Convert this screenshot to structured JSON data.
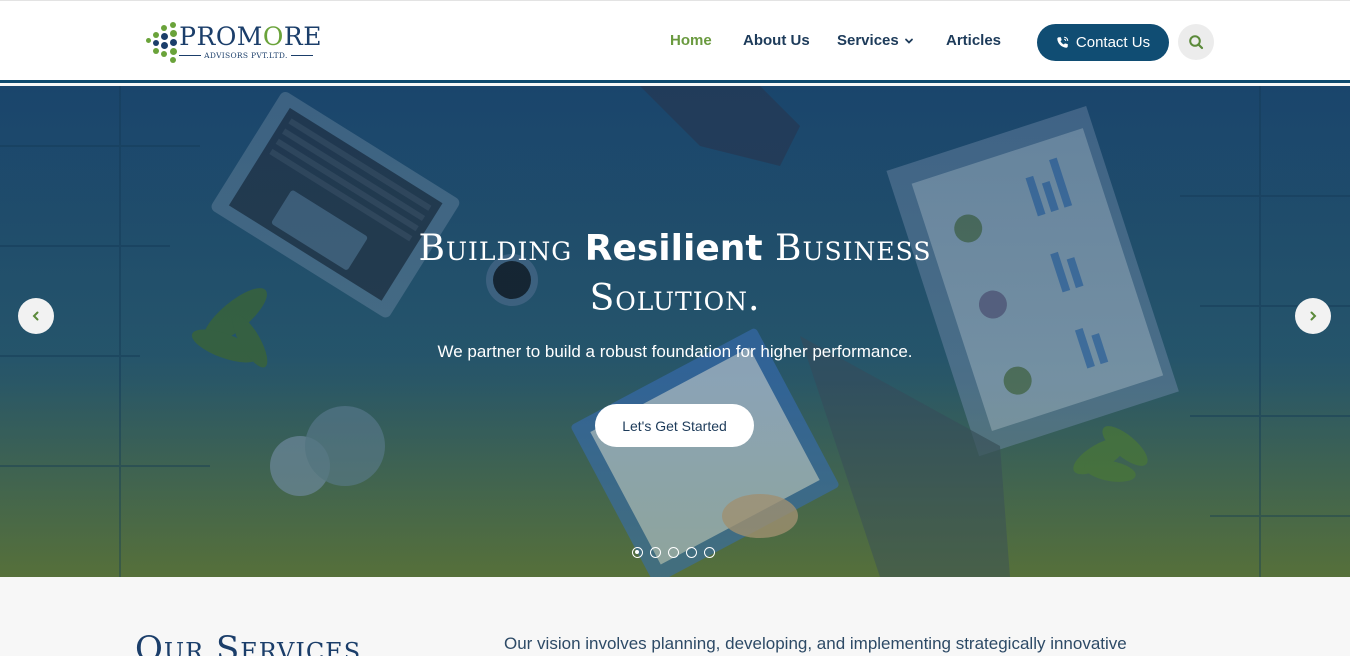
{
  "logo": {
    "name_prefix": "PROM",
    "name_o": "O",
    "name_suffix": "RE",
    "tagline": "ADVISORS PVT.LTD.",
    "brand_blue": "#1b3e6a",
    "brand_green": "#6aa33a"
  },
  "nav": {
    "items": [
      {
        "label": "Home",
        "active": true
      },
      {
        "label": "About Us"
      },
      {
        "label": "Services",
        "has_dropdown": true
      },
      {
        "label": "Articles"
      }
    ],
    "contact_label": "Contact Us",
    "contact_icon": "phone-icon",
    "search_icon": "search-icon"
  },
  "hero": {
    "title_word1": "Building",
    "title_bold": "Resilient",
    "title_word3": "Business",
    "title_line2": "Solution.",
    "subtitle": "We partner to build a robust foundation for higher performance.",
    "cta_label": "Let's Get Started",
    "slides_count": 5,
    "active_slide": 1
  },
  "services": {
    "title": "Our Services",
    "intro": "Our vision involves planning, developing, and implementing strategically innovative"
  },
  "colors": {
    "accent_green": "#6a9a3f",
    "primary_blue": "#104d73"
  }
}
